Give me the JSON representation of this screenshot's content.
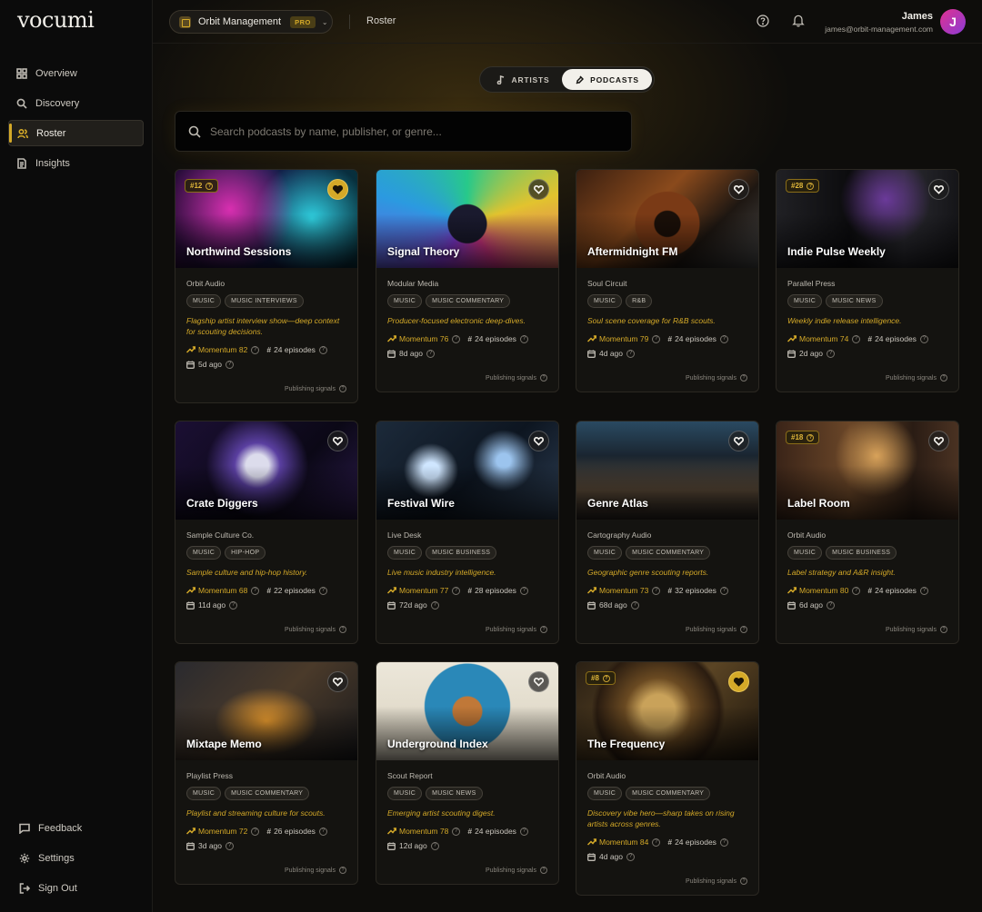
{
  "app": {
    "logo": "vocumi"
  },
  "sidebar": {
    "items": [
      {
        "label": "Overview",
        "icon": "grid-icon"
      },
      {
        "label": "Discovery",
        "icon": "search-icon"
      },
      {
        "label": "Roster",
        "icon": "users-icon",
        "active": true
      },
      {
        "label": "Insights",
        "icon": "document-icon"
      }
    ],
    "bottom": [
      {
        "label": "Feedback",
        "icon": "chat-icon"
      },
      {
        "label": "Settings",
        "icon": "gear-icon"
      },
      {
        "label": "Sign Out",
        "icon": "sign-out-icon"
      }
    ]
  },
  "topbar": {
    "org_name": "Orbit Management",
    "org_badge": "PRO",
    "breadcrumb": "Roster",
    "user_name": "James",
    "user_email": "james@orbit-management.com",
    "avatar_initial": "J"
  },
  "toggle": {
    "artists_label": "ARTISTS",
    "podcasts_label": "PODCASTS",
    "selected": "PODCASTS"
  },
  "search": {
    "placeholder": "Search podcasts by name, publisher, or genre..."
  },
  "colors": {
    "accent": "#d4a928",
    "background": "#0e0d0b",
    "card": "#141310"
  },
  "labels": {
    "signals": "Publishing signals",
    "momentum_prefix": "Momentum",
    "episodes_suffix": "episodes"
  },
  "cards": [
    {
      "title": "Northwind Sessions",
      "rank": "#12",
      "favorite": true,
      "publisher": "Orbit Audio",
      "tags": [
        "MUSIC",
        "MUSIC INTERVIEWS"
      ],
      "description": "Flagship artist interview show—deep context for scouting decisions.",
      "momentum": "Momentum 82",
      "episodes": "24 episodes",
      "ago": "5d ago",
      "art": "sonic"
    },
    {
      "title": "Signal Theory",
      "rank": "",
      "favorite": false,
      "publisher": "Modular Media",
      "tags": [
        "MUSIC",
        "MUSIC COMMENTARY"
      ],
      "description": "Producer-focused electronic deep-dives.",
      "momentum": "Momentum 76",
      "episodes": "24 episodes",
      "ago": "8d ago",
      "art": "neon"
    },
    {
      "title": "Aftermidnight FM",
      "rank": "",
      "favorite": false,
      "publisher": "Soul Circuit",
      "tags": [
        "MUSIC",
        "R&B"
      ],
      "description": "Soul scene coverage for R&B scouts.",
      "momentum": "Momentum 79",
      "episodes": "24 episodes",
      "ago": "4d ago",
      "art": "copper"
    },
    {
      "title": "Indie Pulse Weekly",
      "rank": "#28",
      "favorite": false,
      "publisher": "Parallel Press",
      "tags": [
        "MUSIC",
        "MUSIC NEWS"
      ],
      "description": "Weekly indie release intelligence.",
      "momentum": "Momentum 74",
      "episodes": "24 episodes",
      "ago": "2d ago",
      "art": "studio"
    },
    {
      "title": "Crate Diggers",
      "rank": "",
      "favorite": false,
      "publisher": "Sample Culture Co.",
      "tags": [
        "MUSIC",
        "HIP-HOP"
      ],
      "description": "Sample culture and hip-hop history.",
      "momentum": "Momentum 68",
      "episodes": "22 episodes",
      "ago": "11d ago",
      "art": "orb"
    },
    {
      "title": "Festival Wire",
      "rank": "",
      "favorite": false,
      "publisher": "Live Desk",
      "tags": [
        "MUSIC",
        "MUSIC BUSINESS"
      ],
      "description": "Live music industry intelligence.",
      "momentum": "Momentum 77",
      "episodes": "28 episodes",
      "ago": "72d ago",
      "art": "chain"
    },
    {
      "title": "Genre Atlas",
      "rank": "",
      "favorite": false,
      "publisher": "Cartography Audio",
      "tags": [
        "MUSIC",
        "MUSIC COMMENTARY"
      ],
      "description": "Geographic genre scouting reports.",
      "momentum": "Momentum 73",
      "episodes": "32 episodes",
      "ago": "68d ago",
      "art": "mixer"
    },
    {
      "title": "Label Room",
      "rank": "#18",
      "favorite": false,
      "publisher": "Orbit Audio",
      "tags": [
        "MUSIC",
        "MUSIC BUSINESS"
      ],
      "description": "Label strategy and A&R insight.",
      "momentum": "Momentum 80",
      "episodes": "24 episodes",
      "ago": "6d ago",
      "art": "records"
    },
    {
      "title": "Mixtape Memo",
      "rank": "",
      "favorite": false,
      "publisher": "Playlist Press",
      "tags": [
        "MUSIC",
        "MUSIC COMMENTARY"
      ],
      "description": "Playlist and streaming culture for scouts.",
      "momentum": "Momentum 72",
      "episodes": "26 episodes",
      "ago": "3d ago",
      "art": "hands"
    },
    {
      "title": "Underground Index",
      "rank": "",
      "favorite": false,
      "publisher": "Scout Report",
      "tags": [
        "MUSIC",
        "MUSIC NEWS"
      ],
      "description": "Emerging artist scouting digest.",
      "momentum": "Momentum 78",
      "episodes": "24 episodes",
      "ago": "12d ago",
      "art": "mic"
    },
    {
      "title": "The Frequency",
      "rank": "#8",
      "favorite": true,
      "publisher": "Orbit Audio",
      "tags": [
        "MUSIC",
        "MUSIC COMMENTARY"
      ],
      "description": "Discovery vibe hero—sharp takes on rising artists across genres.",
      "momentum": "Momentum 84",
      "episodes": "24 episodes",
      "ago": "4d ago",
      "art": "gear"
    }
  ]
}
